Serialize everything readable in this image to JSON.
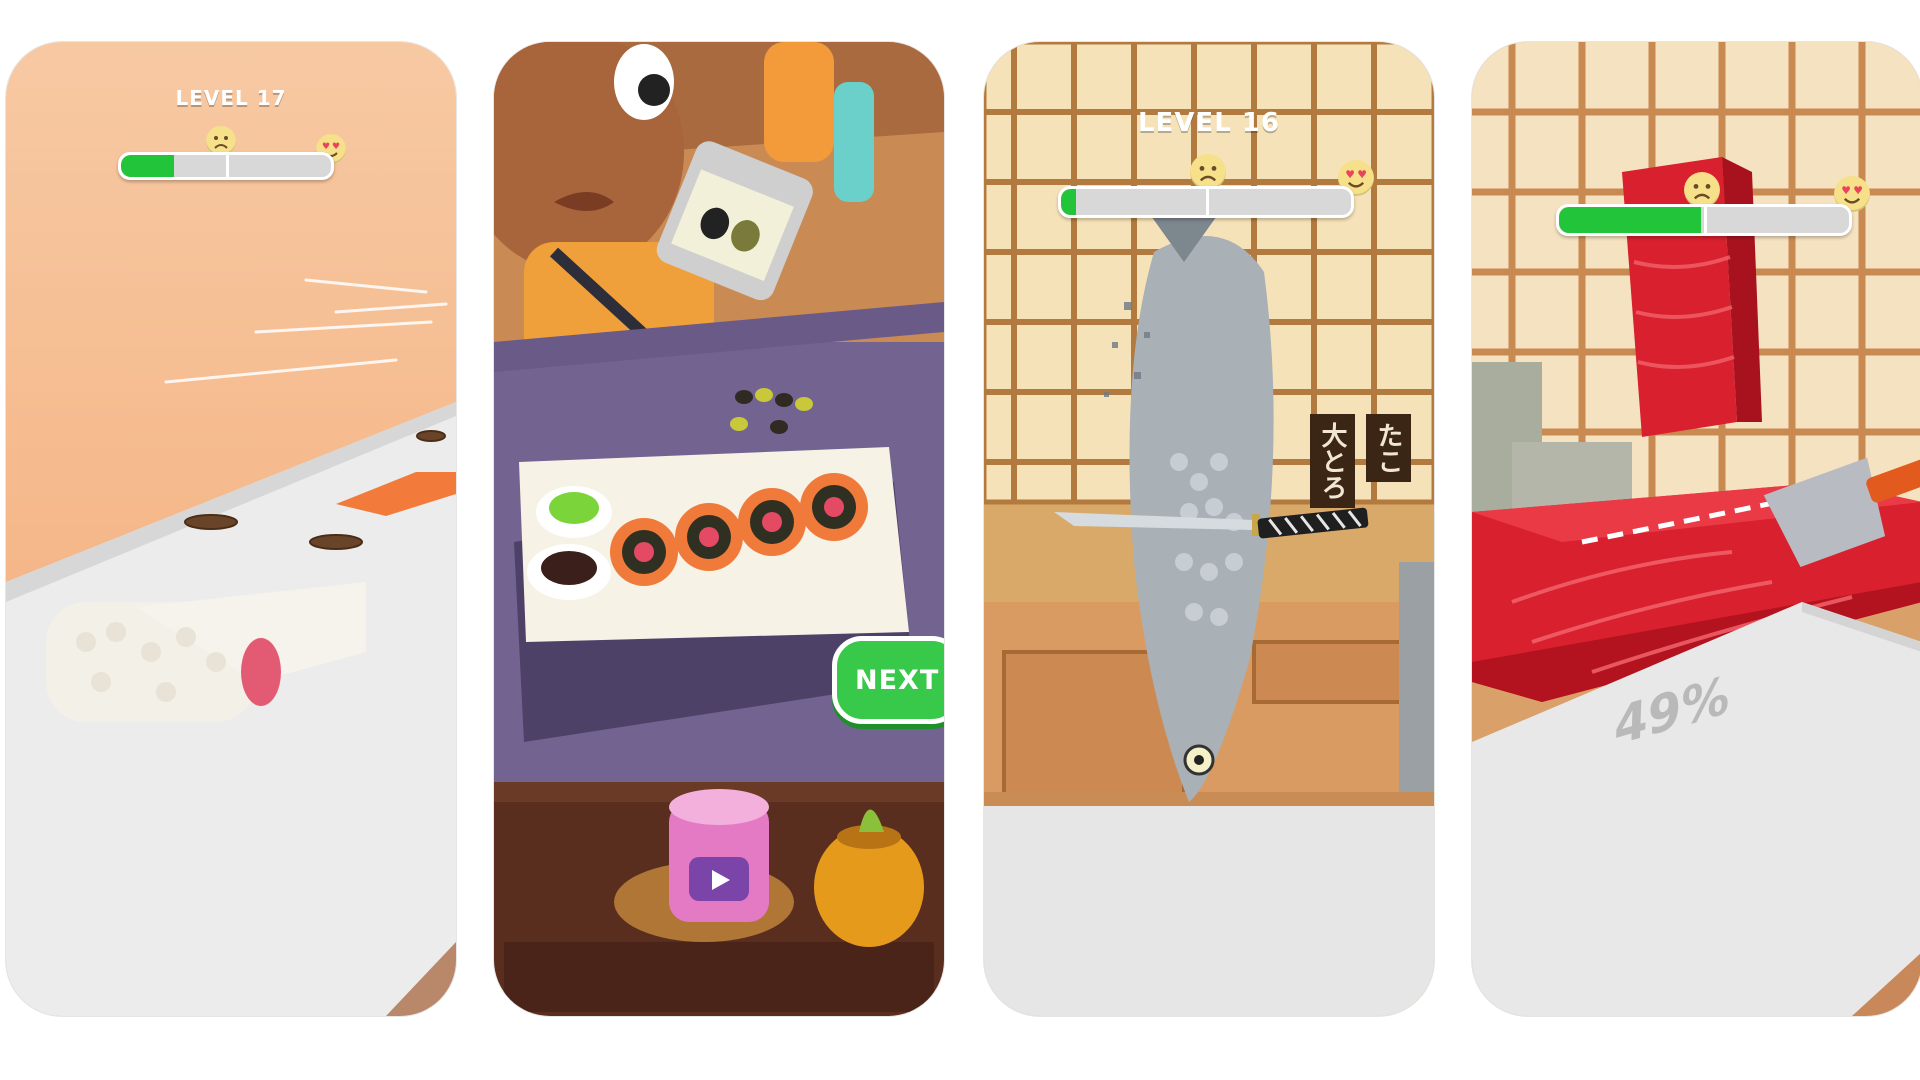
{
  "screens": [
    {
      "level_label": "LEVEL 17",
      "progress": 0.25
    },
    {
      "next_label": "NEXT"
    },
    {
      "level_label": "LEVEL 16",
      "progress": 0.05,
      "signs": [
        "大とろ",
        "たこ"
      ]
    },
    {
      "progress": 0.49,
      "board_percent": "49%"
    }
  ],
  "colors": {
    "progress_fill": "#22c43a",
    "progress_track": "#d8d8d8",
    "next_button": "#38c84a",
    "tuna_red": "#d8202e",
    "salmon": "#f07a3a"
  },
  "icons": [
    "sad-face-icon",
    "heart-eyes-face-icon",
    "video-clapper-icon",
    "knife-icon",
    "cleaver-icon"
  ]
}
